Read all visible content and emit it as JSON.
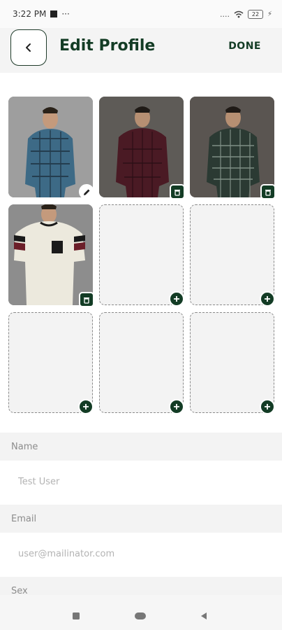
{
  "status_bar": {
    "time": "3:22 PM",
    "extra": "···",
    "signal": "....",
    "battery": "22"
  },
  "header": {
    "title": "Edit Profile",
    "done_label": "DONE",
    "back_icon": "chevron-left-icon"
  },
  "photos": [
    {
      "slot": 1,
      "shirt_color": "#3d6a86",
      "action_icon": "pencil-icon"
    },
    {
      "slot": 2,
      "shirt_color": "#4a1a24",
      "action_icon": "trash-icon"
    },
    {
      "slot": 3,
      "shirt_color": "#2b3a33",
      "action_icon": "trash-icon"
    },
    {
      "slot": 4,
      "shirt_color": "#ece9dd",
      "action_icon": "trash-icon"
    }
  ],
  "empty_slots": 5,
  "add_icon": "plus-icon",
  "form": {
    "name_label": "Name",
    "name_placeholder": "Test User",
    "email_label": "Email",
    "email_placeholder": "user@mailinator.com",
    "sex_label": "Sex"
  },
  "colors": {
    "accent": "#133c25",
    "placeholder": "#b3b3b3"
  }
}
